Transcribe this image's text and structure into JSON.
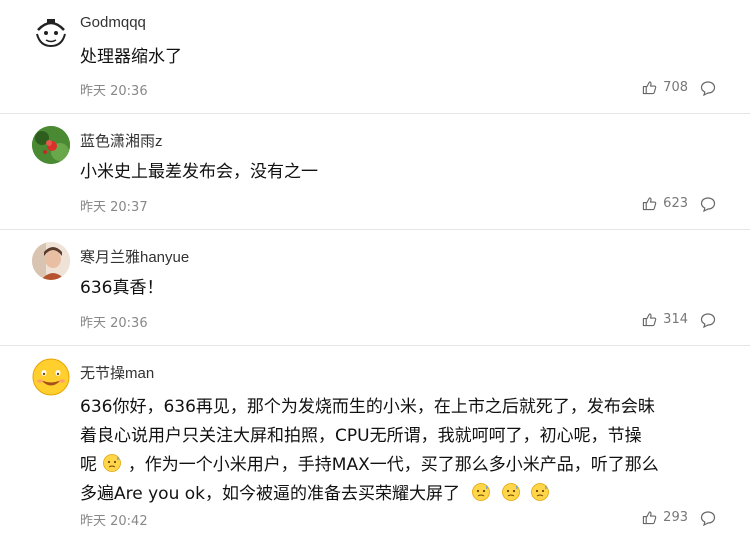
{
  "comments": [
    {
      "username": "Godmqqq",
      "text": "处理器缩水了",
      "time": "昨天 20:36",
      "likes": "708",
      "avatar_icon": "cartoon-face-avatar"
    },
    {
      "username": "蓝色潇湘雨z",
      "text": "小米史上最差发布会，没有之一",
      "time": "昨天 20:37",
      "likes": "623",
      "avatar_icon": "flower-photo-avatar"
    },
    {
      "username": "寒月兰雅hanyue",
      "text": "636真香！",
      "time": "昨天 20:36",
      "likes": "314",
      "avatar_icon": "person-photo-avatar"
    },
    {
      "username": "无节操man",
      "text_lines": [
        "636你好，636再见，那个为发烧而生的小米，在上市之后就死了，发布会昧",
        "着良心说用户只关注大屏和拍照，CPU无所谓，我就呵呵了，初心呢，节操",
        "呢",
        "，作为一个小米用户，手持MAX一代，买了那么多小米产品，听了那么",
        "多遍Are you ok，如今被逼的准备去买荣耀大屏了"
      ],
      "time": "昨天 20:42",
      "likes": "293",
      "avatar_icon": "smiley-emoji-avatar"
    }
  ],
  "icons": {
    "like": "thumbs-up-icon",
    "reply": "comment-bubble-icon",
    "emoji": "awkward-emoji-icon"
  },
  "colors": {
    "text": "#111111",
    "meta": "#888888",
    "divider": "#e6e6e6"
  }
}
